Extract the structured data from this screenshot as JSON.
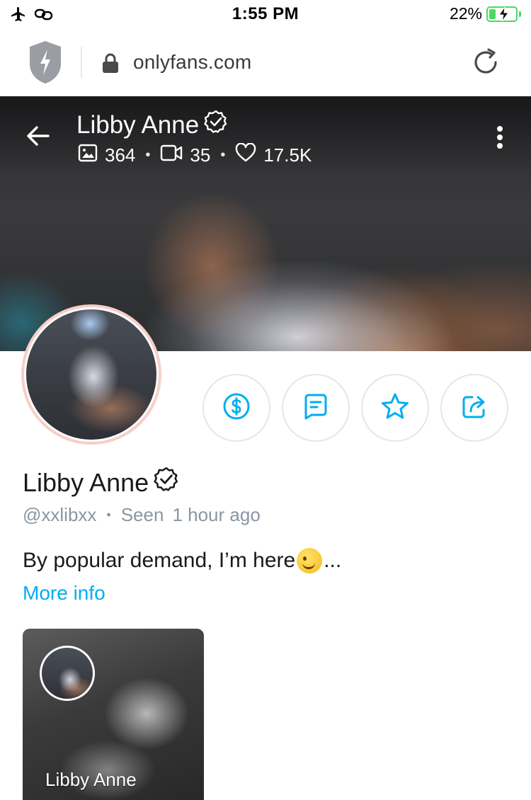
{
  "status_bar": {
    "time": "1:55 PM",
    "battery_percent": "22%",
    "battery_level": 0.22,
    "icons": [
      "airplane-icon",
      "link-icon"
    ]
  },
  "browser": {
    "url": "onlyfans.com"
  },
  "cover": {
    "name": "Libby Anne",
    "stats": {
      "photos": "364",
      "videos": "35",
      "likes": "17.5K"
    }
  },
  "actions": [
    {
      "name": "tip-button",
      "icon": "dollar-icon"
    },
    {
      "name": "message-button",
      "icon": "message-icon"
    },
    {
      "name": "favorite-button",
      "icon": "star-icon"
    },
    {
      "name": "share-button",
      "icon": "share-icon"
    }
  ],
  "profile": {
    "name": "Libby Anne",
    "username": "@xxlibxx",
    "seen_label": "Seen",
    "seen_time": "1 hour ago",
    "bio_text": "By popular demand, I’m here",
    "bio_suffix": "...",
    "more_info": "More info"
  },
  "card": {
    "name": "Libby Anne"
  },
  "colors": {
    "accent": "#00aeef",
    "muted": "#8a96a3",
    "battery": "#4cd964",
    "avatar_ring": "#f6cfc8"
  }
}
